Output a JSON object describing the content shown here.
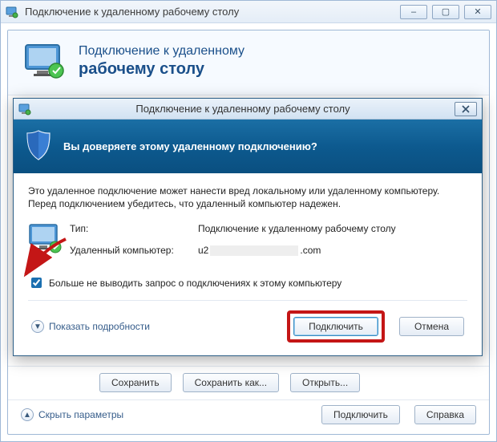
{
  "outerWindow": {
    "title": "Подключение к удаленному рабочему столу",
    "buttons": {
      "min": "–",
      "max": "▢",
      "close": "✕"
    },
    "banner": {
      "line1": "Подключение к удаленному",
      "line2": "рабочему столу"
    },
    "saveBtn": "Сохранить",
    "saveAsBtn": "Сохранить как...",
    "openBtn": "Открыть...",
    "collapseLabel": "Скрыть параметры",
    "connectBtn": "Подключить",
    "helpBtn": "Справка"
  },
  "dialog": {
    "title": "Подключение к удаленному рабочему столу",
    "trustQuestion": "Вы доверяете этому удаленному подключению?",
    "warningLine1": "Это удаленное подключение может нанести вред локальному или удаленному компьютеру.",
    "warningLine2": "Перед подключением убедитесь, что удаленный компьютер надежен.",
    "typeLabel": "Тип:",
    "typeValue": "Подключение к удаленному рабочему столу",
    "remoteLabel": "Удаленный компьютер:",
    "remotePrefix": "u2",
    "remoteSuffix": ".com",
    "checkboxLabel": "Больше не выводить запрос о подключениях к этому компьютеру",
    "checkboxChecked": true,
    "detailsLabel": "Показать подробности",
    "connectBtn": "Подключить",
    "cancelBtn": "Отмена"
  }
}
